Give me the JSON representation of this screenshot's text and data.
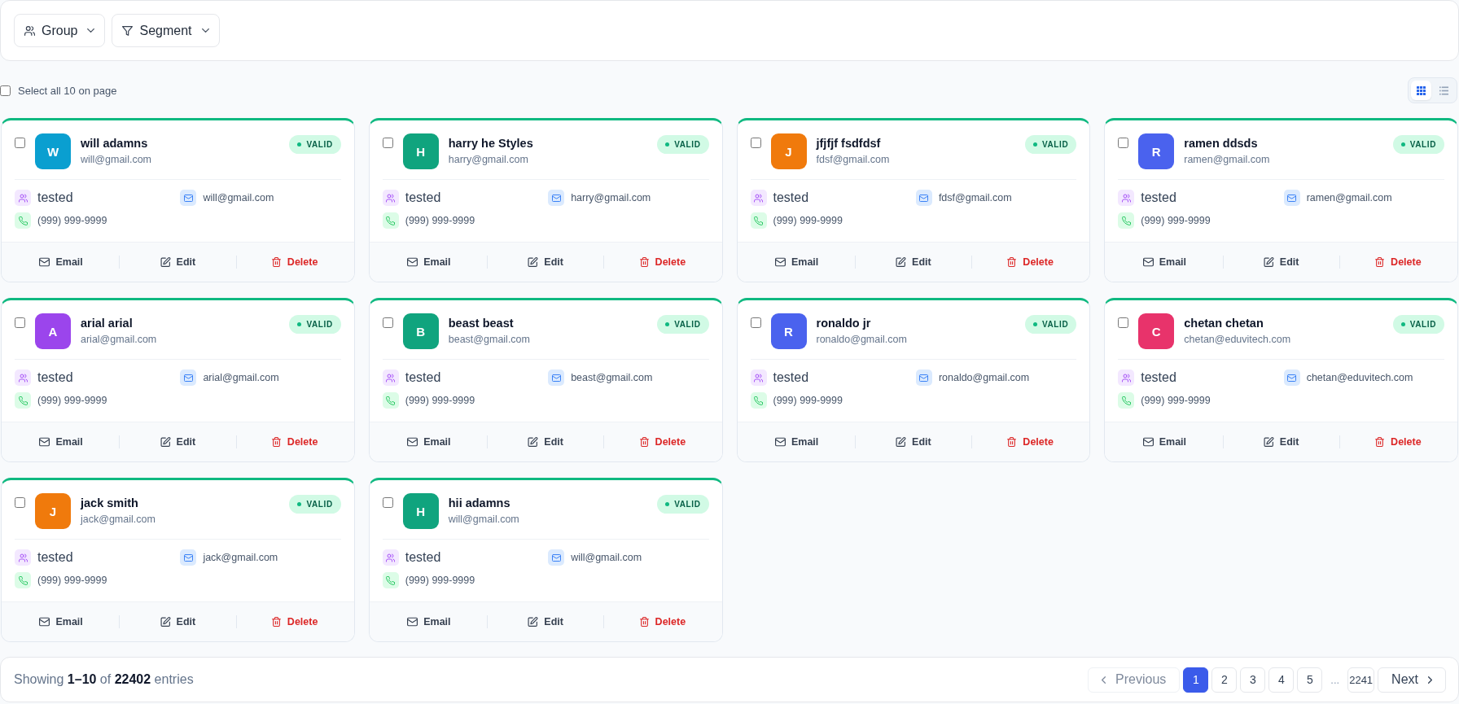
{
  "toolbar": {
    "filters": [
      {
        "label": "Group",
        "kind": "group"
      },
      {
        "label": "Segment",
        "kind": "segment"
      }
    ]
  },
  "select_all": {
    "label": "Select all 10 on page",
    "checked": false
  },
  "view_modes": [
    {
      "kind": "grid",
      "selected": true
    },
    {
      "kind": "list",
      "selected": false
    }
  ],
  "contacts": [
    {
      "initial": "W",
      "color": "#0a9fd0",
      "name": "will adamns",
      "email": "will@gmail.com",
      "status": "VALID",
      "group": "tested",
      "contact_email": "will@gmail.com",
      "phone": "(999) 999-9999",
      "selected": false,
      "actions": [
        {
          "kind": "email",
          "label": "Email"
        },
        {
          "kind": "edit",
          "label": "Edit"
        },
        {
          "kind": "delete",
          "label": "Delete"
        }
      ]
    },
    {
      "initial": "H",
      "color": "#10a47e",
      "name": "harry he Styles",
      "email": "harry@gmail.com",
      "status": "VALID",
      "group": "tested",
      "contact_email": "harry@gmail.com",
      "phone": "(999) 999-9999",
      "selected": false,
      "actions": [
        {
          "kind": "email",
          "label": "Email"
        },
        {
          "kind": "edit",
          "label": "Edit"
        },
        {
          "kind": "delete",
          "label": "Delete"
        }
      ]
    },
    {
      "initial": "J",
      "color": "#f07a0c",
      "name": "jfjfjf fsdfdsf",
      "email": "fdsf@gmail.com",
      "status": "VALID",
      "group": "tested",
      "contact_email": "fdsf@gmail.com",
      "phone": "(999) 999-9999",
      "selected": false,
      "actions": [
        {
          "kind": "email",
          "label": "Email"
        },
        {
          "kind": "edit",
          "label": "Edit"
        },
        {
          "kind": "delete",
          "label": "Delete"
        }
      ]
    },
    {
      "initial": "R",
      "color": "#4a62ee",
      "name": "ramen ddsds",
      "email": "ramen@gmail.com",
      "status": "VALID",
      "group": "tested",
      "contact_email": "ramen@gmail.com",
      "phone": "(999) 999-9999",
      "selected": false,
      "actions": [
        {
          "kind": "email",
          "label": "Email"
        },
        {
          "kind": "edit",
          "label": "Edit"
        },
        {
          "kind": "delete",
          "label": "Delete"
        }
      ]
    },
    {
      "initial": "A",
      "color": "#9b45ec",
      "name": "arial arial",
      "email": "arial@gmail.com",
      "status": "VALID",
      "group": "tested",
      "contact_email": "arial@gmail.com",
      "phone": "(999) 999-9999",
      "selected": false,
      "actions": [
        {
          "kind": "email",
          "label": "Email"
        },
        {
          "kind": "edit",
          "label": "Edit"
        },
        {
          "kind": "delete",
          "label": "Delete"
        }
      ]
    },
    {
      "initial": "B",
      "color": "#10a47e",
      "name": "beast beast",
      "email": "beast@gmail.com",
      "status": "VALID",
      "group": "tested",
      "contact_email": "beast@gmail.com",
      "phone": "(999) 999-9999",
      "selected": false,
      "actions": [
        {
          "kind": "email",
          "label": "Email"
        },
        {
          "kind": "edit",
          "label": "Edit"
        },
        {
          "kind": "delete",
          "label": "Delete"
        }
      ]
    },
    {
      "initial": "R",
      "color": "#4a62ee",
      "name": "ronaldo jr",
      "email": "ronaldo@gmail.com",
      "status": "VALID",
      "group": "tested",
      "contact_email": "ronaldo@gmail.com",
      "phone": "(999) 999-9999",
      "selected": false,
      "actions": [
        {
          "kind": "email",
          "label": "Email"
        },
        {
          "kind": "edit",
          "label": "Edit"
        },
        {
          "kind": "delete",
          "label": "Delete"
        }
      ]
    },
    {
      "initial": "C",
      "color": "#e8336b",
      "name": "chetan chetan",
      "email": "chetan@eduvitech.com",
      "status": "VALID",
      "group": "tested",
      "contact_email": "chetan@eduvitech.com",
      "phone": "(999) 999-9999",
      "selected": false,
      "actions": [
        {
          "kind": "email",
          "label": "Email"
        },
        {
          "kind": "edit",
          "label": "Edit"
        },
        {
          "kind": "delete",
          "label": "Delete"
        }
      ]
    },
    {
      "initial": "J",
      "color": "#f07a0c",
      "name": "jack smith",
      "email": "jack@gmail.com",
      "status": "VALID",
      "group": "tested",
      "contact_email": "jack@gmail.com",
      "phone": "(999) 999-9999",
      "selected": false,
      "actions": [
        {
          "kind": "email",
          "label": "Email"
        },
        {
          "kind": "edit",
          "label": "Edit"
        },
        {
          "kind": "delete",
          "label": "Delete"
        }
      ]
    },
    {
      "initial": "H",
      "color": "#10a47e",
      "name": "hii adamns",
      "email": "will@gmail.com",
      "status": "VALID",
      "group": "tested",
      "contact_email": "will@gmail.com",
      "phone": "(999) 999-9999",
      "selected": false,
      "actions": [
        {
          "kind": "email",
          "label": "Email"
        },
        {
          "kind": "edit",
          "label": "Edit"
        },
        {
          "kind": "delete",
          "label": "Delete"
        }
      ]
    }
  ],
  "pagination": {
    "summary": "Showing **1–10** of **22402** entries",
    "previous": {
      "label": "Previous",
      "disabled": true
    },
    "pages": [
      {
        "label": "1",
        "selected": true
      },
      {
        "label": "2",
        "selected": false
      },
      {
        "label": "3",
        "selected": false
      },
      {
        "label": "4",
        "selected": false
      },
      {
        "label": "5",
        "selected": false
      }
    ],
    "ellipsis": "...",
    "last_page": {
      "label": "2241",
      "selected": false
    },
    "next": {
      "label": "Next",
      "disabled": false
    }
  }
}
